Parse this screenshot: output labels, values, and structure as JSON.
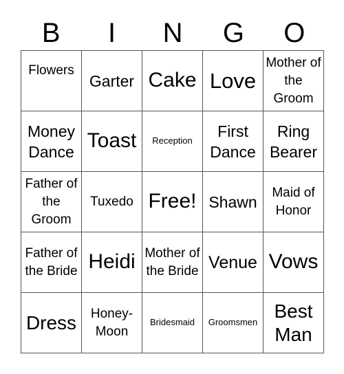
{
  "header": [
    "B",
    "I",
    "N",
    "G",
    "O"
  ],
  "cells": [
    "Flowers",
    "Garter",
    "Cake",
    "Love",
    "Mother of the Groom",
    "Money Dance",
    "Toast",
    "Reception",
    "First Dance",
    "Ring Bearer",
    "Father of the Groom",
    "Tuxedo",
    "Free!",
    "Shawn",
    "Maid of Honor",
    "Father of the Bride",
    "Heidi",
    "Mother of the Bride",
    "Venue",
    "Vows",
    "Dress",
    "Honey-Moon",
    "Bridesmaid",
    "Groomsmen",
    "Best Man"
  ]
}
